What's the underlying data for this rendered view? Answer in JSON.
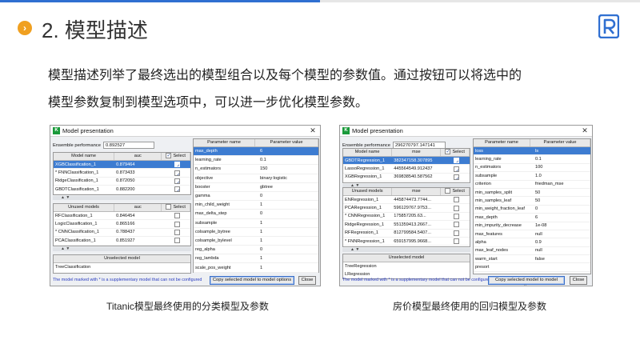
{
  "slide": {
    "section_number_icon": "chevron-right-icon",
    "title": "2. 模型描述",
    "body_line1": "模型描述列举了最终选出的模型组合以及每个模型的参数值。通过按钮可以将选中的",
    "body_line2": "模型参数复制到模型选项中，可以进一步优化模型参数。",
    "caption_left": "Titanic模型最终使用的分类模型及参数",
    "caption_right": "房价模型最终使用的回归模型及参数",
    "logo_icon": "brand-r-logo",
    "colors": {
      "accent_blue": "#2f6fd1",
      "bullet_orange": "#f0a020",
      "selection_blue": "#3d7cd1"
    }
  },
  "left_window": {
    "title": "Model presentation",
    "perf_label": "Ensemble performance",
    "perf_value": "0.892527",
    "used_headers": [
      "Model name",
      "auc",
      "Select"
    ],
    "used_rows": [
      {
        "name": "XGBClassification_1",
        "score": "0.879464",
        "checked": true,
        "selected": true
      },
      {
        "name": "* FNNClassification_1",
        "score": "0.873433",
        "checked": true,
        "selected": false
      },
      {
        "name": "RidgeClassification_1",
        "score": "0.872050",
        "checked": true,
        "selected": false
      },
      {
        "name": "GBDTClassification_1",
        "score": "0.882200",
        "checked": true,
        "selected": false
      }
    ],
    "unused_headers": [
      "Unused models",
      "auc",
      "Select"
    ],
    "unused_rows": [
      {
        "name": "RFClassification_1",
        "score": "0.846454",
        "checked": false
      },
      {
        "name": "LogicClassification_1",
        "score": "0.865166",
        "checked": false
      },
      {
        "name": "* CNNClassification_1",
        "score": "0.788437",
        "checked": false
      },
      {
        "name": "PCAClassification_1",
        "score": "0.851927",
        "checked": false
      }
    ],
    "unselected_header": "Unselected model",
    "unselected_rows": [
      "TreeClassification"
    ],
    "param_headers": [
      "Parameter name",
      "Parameter value"
    ],
    "params": [
      {
        "name": "max_depth",
        "value": "6",
        "selected": true
      },
      {
        "name": "learning_rate",
        "value": "0.1",
        "selected": false
      },
      {
        "name": "n_estimators",
        "value": "150",
        "selected": false
      },
      {
        "name": "objective",
        "value": "binary:logistic",
        "selected": false
      },
      {
        "name": "booster",
        "value": "gbtree",
        "selected": false
      },
      {
        "name": "gamma",
        "value": "0",
        "selected": false
      },
      {
        "name": "min_child_weight",
        "value": "1",
        "selected": false
      },
      {
        "name": "max_delta_step",
        "value": "0",
        "selected": false
      },
      {
        "name": "subsample",
        "value": "1",
        "selected": false
      },
      {
        "name": "colsample_bytree",
        "value": "1",
        "selected": false
      },
      {
        "name": "colsample_bylevel",
        "value": "1",
        "selected": false
      },
      {
        "name": "reg_alpha",
        "value": "0",
        "selected": false
      },
      {
        "name": "reg_lambda",
        "value": "1",
        "selected": false
      },
      {
        "name": "scale_pos_weight",
        "value": "1",
        "selected": false
      }
    ],
    "footnote": "The model marked with * is a supplementary model that can not be configured",
    "copy_button": "Copy selected model to model options",
    "close_button": "Close"
  },
  "right_window": {
    "title": "Model presentation",
    "perf_label": "Ensemble performance",
    "perf_value": "296270797.147141",
    "used_headers": [
      "Model name",
      "mse",
      "Select"
    ],
    "used_rows": [
      {
        "name": "GBDTRegression_1",
        "score": "382347158.307895",
        "checked": true,
        "selected": true
      },
      {
        "name": "LassoRegression_1",
        "score": "445564549.912437",
        "checked": true,
        "selected": false
      },
      {
        "name": "XGBRegression_1",
        "score": "369838540.587562",
        "checked": true,
        "selected": false
      }
    ],
    "unused_headers": [
      "Unused models",
      "mse",
      "Select"
    ],
    "unused_rows": [
      {
        "name": "ENRegression_1",
        "score": "445874473.7744...",
        "checked": false
      },
      {
        "name": "PCARegression_1",
        "score": "596129767.9753...",
        "checked": false
      },
      {
        "name": "* CNNRegression_1",
        "score": "175857205.63...",
        "checked": false
      },
      {
        "name": "RidgeRegression_1",
        "score": "551359413.2667...",
        "checked": false
      },
      {
        "name": "RFRegression_1",
        "score": "812799584.5407...",
        "checked": false
      },
      {
        "name": "* FNNRegression_1",
        "score": "659157995.9668...",
        "checked": false
      }
    ],
    "unselected_header": "Unselected model",
    "unselected_rows": [
      "TreeRegression",
      "LRegression"
    ],
    "param_headers": [
      "Parameter name",
      "Parameter value"
    ],
    "params": [
      {
        "name": "loss",
        "value": "ls",
        "selected": true
      },
      {
        "name": "learning_rate",
        "value": "0.1",
        "selected": false
      },
      {
        "name": "n_estimators",
        "value": "100",
        "selected": false
      },
      {
        "name": "subsample",
        "value": "1.0",
        "selected": false
      },
      {
        "name": "criterion",
        "value": "friedman_mse",
        "selected": false
      },
      {
        "name": "min_samples_split",
        "value": "50",
        "selected": false
      },
      {
        "name": "min_samples_leaf",
        "value": "50",
        "selected": false
      },
      {
        "name": "min_weight_fraction_leaf",
        "value": "0",
        "selected": false
      },
      {
        "name": "max_depth",
        "value": "6",
        "selected": false
      },
      {
        "name": "min_impurity_decrease",
        "value": "1e-08",
        "selected": false
      },
      {
        "name": "max_features",
        "value": "null",
        "selected": false
      },
      {
        "name": "alpha",
        "value": "0.9",
        "selected": false
      },
      {
        "name": "max_leaf_nodes",
        "value": "null",
        "selected": false
      },
      {
        "name": "warm_start",
        "value": "false",
        "selected": false
      },
      {
        "name": "presort",
        "value": "",
        "selected": false
      }
    ],
    "footnote": "The model marked with * is a supplementary model that can not be configured",
    "copy_button": "Copy selected model to model options",
    "close_button": "Close"
  }
}
